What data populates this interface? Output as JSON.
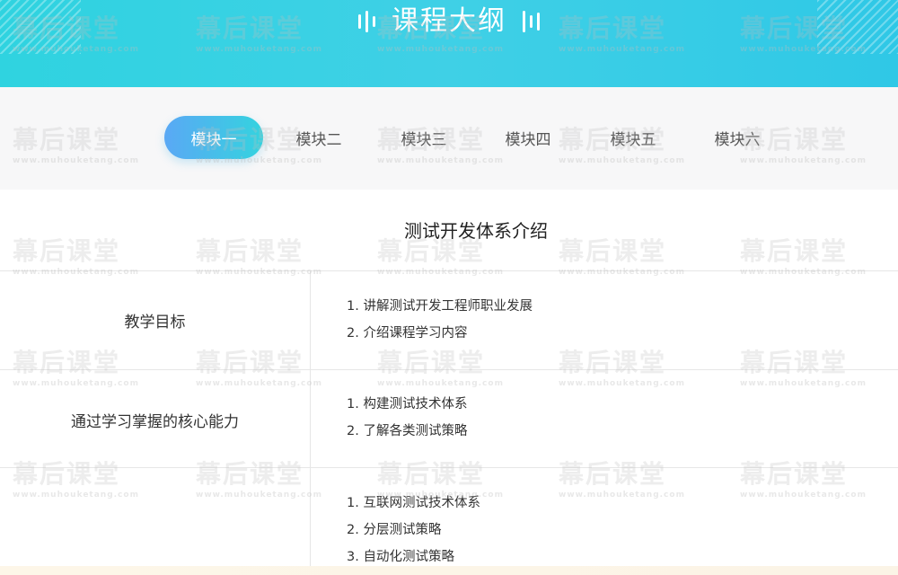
{
  "header": {
    "title": "课程大纲"
  },
  "tabs": [
    {
      "label": "模块一",
      "active": true
    },
    {
      "label": "模块二",
      "active": false
    },
    {
      "label": "模块三",
      "active": false
    },
    {
      "label": "模块四",
      "active": false
    },
    {
      "label": "模块五",
      "active": false
    },
    {
      "label": "模块六",
      "active": false
    }
  ],
  "module": {
    "title": "测试开发体系介绍",
    "rows": [
      {
        "label": "教学目标",
        "items": [
          "1. 讲解测试开发工程师职业发展",
          "2. 介绍课程学习内容"
        ]
      },
      {
        "label": "通过学习掌握的核心能力",
        "items": [
          "1. 构建测试技术体系",
          "2. 了解各类测试策略"
        ]
      },
      {
        "label": "",
        "items": [
          "1. 互联网测试技术体系",
          "2. 分层测试策略",
          "3. 自动化测试策略"
        ]
      }
    ]
  },
  "watermark": {
    "text": "幕后课堂",
    "url": "www.muhouketang.com"
  },
  "colors": {
    "header": "#36d0e4",
    "tab_active_start": "#5aa8f5",
    "tab_active_end": "#34d3df"
  }
}
